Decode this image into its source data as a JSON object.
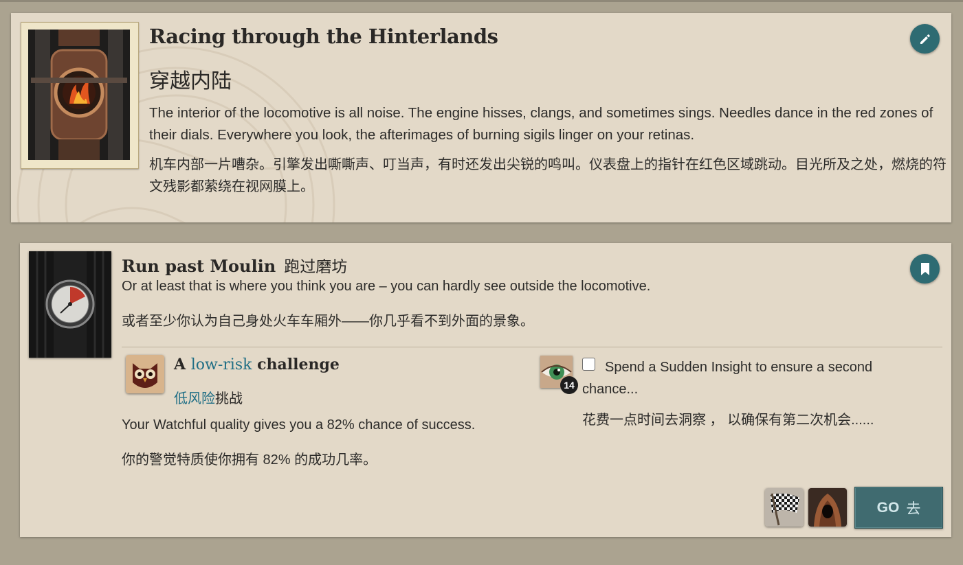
{
  "storylet": {
    "title": "Racing through the Hinterlands",
    "title_cn": "穿越内陆",
    "description": "The interior of the locomotive is all noise. The engine hisses, clangs, and sometimes sings. Needles dance in the red zones of their dials. Everywhere you look, the afterimages of burning sigils linger on your retinas.",
    "description_cn": "机车内部一片嘈杂。引擎发出嘶嘶声、叮当声，有时还发出尖锐的鸣叫。仪表盘上的指针在红色区域跳动。目光所及之处，燃烧的符文残影都萦绕在视网膜上。",
    "edit_icon": "pencil-icon"
  },
  "branch": {
    "title": "Run past Moulin",
    "title_cn": "跑过磨坊",
    "description": "Or at least that is where you think you are – you can hardly see outside the locomotive.",
    "description_cn": "或者至少你认为自己身处火车车厢外——你几乎看不到外面的景象。",
    "bookmark_icon": "bookmark-icon",
    "challenge": {
      "prefix": "A ",
      "risk": "low-risk",
      "suffix": " challenge",
      "risk_cn": "低风险",
      "suffix_cn": "挑战",
      "chance": "Your Watchful quality gives you a 82% chance of success.",
      "chance_cn": "你的警觉特质使你拥有 82% 的成功几率。"
    },
    "second_chance": {
      "count": "14",
      "label": "Spend a Sudden Insight to ensure a second chance...",
      "label_cn": "花费一点时间去洞察 ， 以确保有第二次机会......",
      "checked": false
    },
    "go_label": "GO",
    "go_label_cn": "去"
  },
  "colors": {
    "background": "#aba390",
    "card": "#e3d9c8",
    "accent_teal": "#2e6b72",
    "link_blue": "#1f6e85",
    "go_button": "#406b70"
  }
}
